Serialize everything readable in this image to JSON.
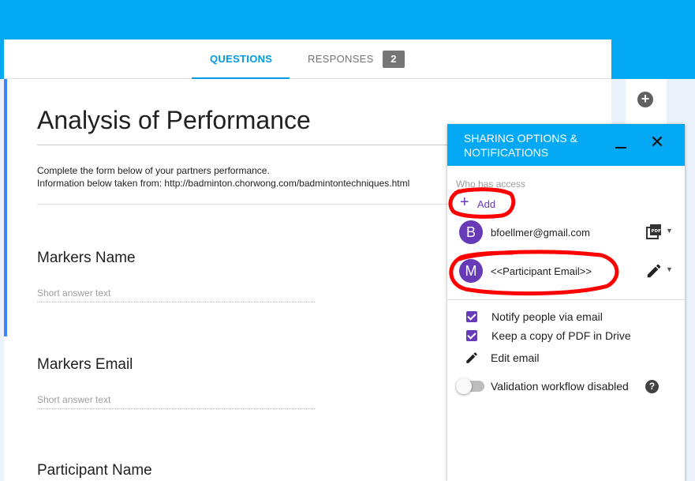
{
  "tabs": {
    "questions_label": "QUESTIONS",
    "responses_label": "RESPONSES",
    "responses_count": "2"
  },
  "form": {
    "title": "Analysis of Performance",
    "description_line1": "Complete the form below of your partners performance.",
    "description_line2": "Information below taken from: http://badminton.chorwong.com/badmintontechniques.html",
    "questions": [
      {
        "title": "Markers Name",
        "answer_placeholder": "Short answer text"
      },
      {
        "title": "Markers Email",
        "answer_placeholder": "Short answer text"
      },
      {
        "title": "Participant Name"
      }
    ]
  },
  "side_toolbar": {
    "add_question_icon": "add-circle-icon"
  },
  "panel": {
    "title": "SHARING OPTIONS & NOTIFICATIONS",
    "who_has_access_label": "Who has access",
    "add_label": "Add",
    "people": [
      {
        "initial": "B",
        "email": "bfoellmer@gmail.com",
        "permission_icon": "pdf-icon"
      },
      {
        "initial": "M",
        "email": "<<Participant Email>>",
        "permission_icon": "pencil-icon"
      }
    ],
    "notify_label": "Notify people via email",
    "keep_copy_label": "Keep a copy of PDF in Drive",
    "edit_email_label": "Edit email",
    "validation_label": "Validation workflow disabled",
    "notify_checked": true,
    "keep_copy_checked": true,
    "validation_enabled": false,
    "accent_color": "#673ab7",
    "header_color": "#03a9f4"
  },
  "annotation_color": "#ff0000"
}
